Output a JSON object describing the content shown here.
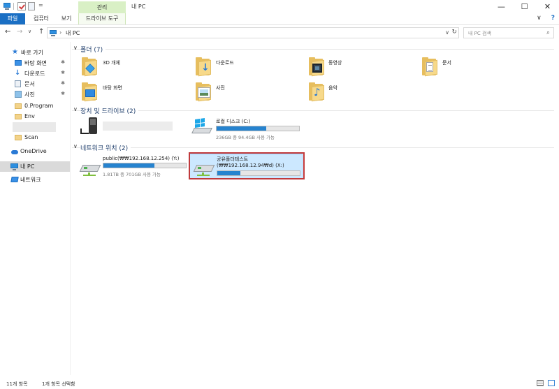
{
  "window": {
    "title": "내 PC",
    "contextual_tab": "관리",
    "minimize": "—",
    "maximize": "☐",
    "close": "✕"
  },
  "ribbon": {
    "tabs": {
      "file": "파일",
      "computer": "컴퓨터",
      "view": "보기",
      "drive_tools": "드라이브 도구"
    },
    "expand": "∨",
    "help": "?"
  },
  "address": {
    "path": "내 PC",
    "search_placeholder": "내 PC 검색",
    "chevron": "›",
    "dropdown": "∨",
    "refresh": "↻",
    "back": "←",
    "forward": "→",
    "recent": "∨",
    "up": "↑",
    "search_glyph": "⌕"
  },
  "nav": {
    "quick_access": "바로 가기",
    "pinned": [
      {
        "label": "바탕 화면",
        "icon": "desktop-icon"
      },
      {
        "label": "다운로드",
        "icon": "download-icon"
      },
      {
        "label": "문서",
        "icon": "documents-icon"
      },
      {
        "label": "사진",
        "icon": "pictures-icon"
      }
    ],
    "folders": [
      {
        "label": "0.Program"
      },
      {
        "label": "Env"
      },
      {
        "label": "Scan"
      }
    ],
    "onedrive": "OneDrive",
    "this_pc": "내 PC",
    "network": "네트워크",
    "pin_glyph": "✱"
  },
  "content": {
    "folders_group": "폴더 (7)",
    "folders": [
      {
        "label": "3D 개체",
        "icon": "3d-objects-icon"
      },
      {
        "label": "다운로드",
        "icon": "downloads-icon"
      },
      {
        "label": "동영상",
        "icon": "videos-icon"
      },
      {
        "label": "문서",
        "icon": "documents-icon"
      },
      {
        "label": "바탕 화면",
        "icon": "desktop-icon"
      },
      {
        "label": "사진",
        "icon": "pictures-icon"
      },
      {
        "label": "음악",
        "icon": "music-icon"
      }
    ],
    "devices_group": "장치 및 드라이브 (2)",
    "local_disk": {
      "name": "로컬 디스크 (C:)",
      "info": "236GB 중 94.4GB 사용 가능",
      "used_fraction": 0.6
    },
    "network_group": "네트워크 위치 (2)",
    "net_drives": [
      {
        "name": "public(₩₩192.168.12.254) (Y:)",
        "info": "1.81TB 중 701GB 사용 가능",
        "used_fraction": 0.62
      },
      {
        "name": "공유폴더테스트",
        "name2": "(₩₩192.168.12.94₩d) (X:)",
        "info": "",
        "used_fraction": 0.28
      }
    ],
    "chevron": "∨"
  },
  "status": {
    "count": "11개 항목",
    "selected": "1개 항목 선택함"
  }
}
